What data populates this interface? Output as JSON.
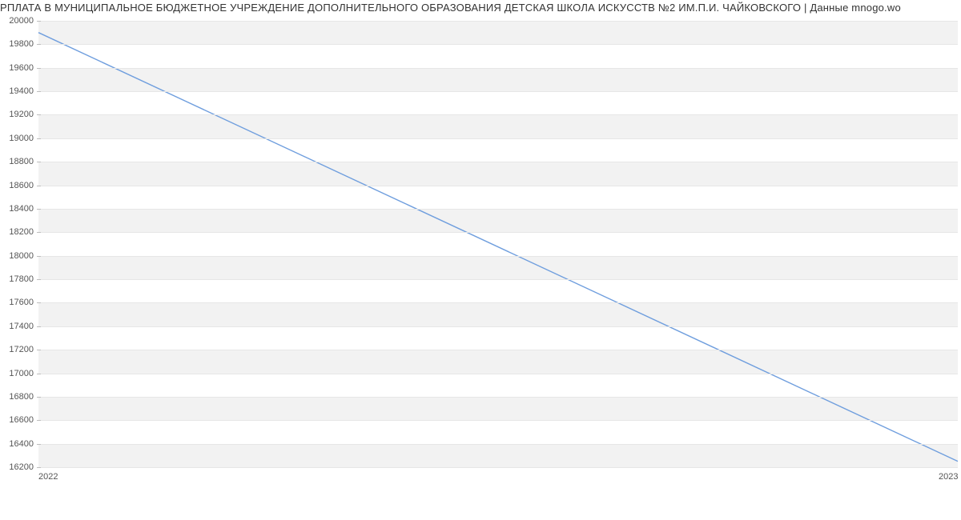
{
  "chart_data": {
    "type": "line",
    "title": "РПЛАТА В МУНИЦИПАЛЬНОЕ БЮДЖЕТНОЕ УЧРЕЖДЕНИЕ ДОПОЛНИТЕЛЬНОГО ОБРАЗОВАНИЯ ДЕТСКАЯ ШКОЛА ИСКУССТВ №2 ИМ.П.И. ЧАЙКОВСКОГО | Данные mnogo.wo",
    "x": [
      2022,
      2023
    ],
    "values": [
      19900,
      16250
    ],
    "xlabel": "",
    "ylabel": "",
    "ylim": [
      16200,
      20000
    ],
    "y_ticks": [
      16200,
      16400,
      16600,
      16800,
      17000,
      17200,
      17400,
      17600,
      17800,
      18000,
      18200,
      18400,
      18600,
      18800,
      19000,
      19200,
      19400,
      19600,
      19800,
      20000
    ],
    "x_ticks": [
      2022,
      2023
    ],
    "line_color": "#6f9ede",
    "band_color": "#f2f2f2"
  }
}
